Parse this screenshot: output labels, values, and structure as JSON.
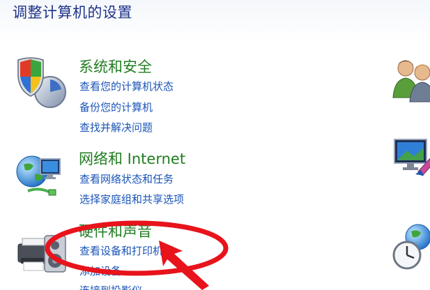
{
  "window": {
    "title": "调整计算机的设置"
  },
  "categories": [
    {
      "title": "系统和安全",
      "icon": "shield-icon",
      "links": [
        "查看您的计算机状态",
        "备份您的计算机",
        "查找并解决问题"
      ]
    },
    {
      "title": "网络和 Internet",
      "icon": "network-globe-icon",
      "links": [
        "查看网络状态和任务",
        "选择家庭组和共享选项"
      ]
    },
    {
      "title": "硬件和声音",
      "icon": "printer-speaker-icon",
      "links": [
        "查看设备和打印机",
        "添加设备",
        "连接到投影仪"
      ]
    }
  ],
  "right_column_icons": [
    "users-icon",
    "display-paintbrush-icon",
    "clock-globe-icon"
  ],
  "annotation": {
    "highlight_color": "#e8131b",
    "shape": "ellipse-with-arrow"
  },
  "colors": {
    "title": "#1e3287",
    "category": "#217d21",
    "link": "#1a54b8"
  }
}
